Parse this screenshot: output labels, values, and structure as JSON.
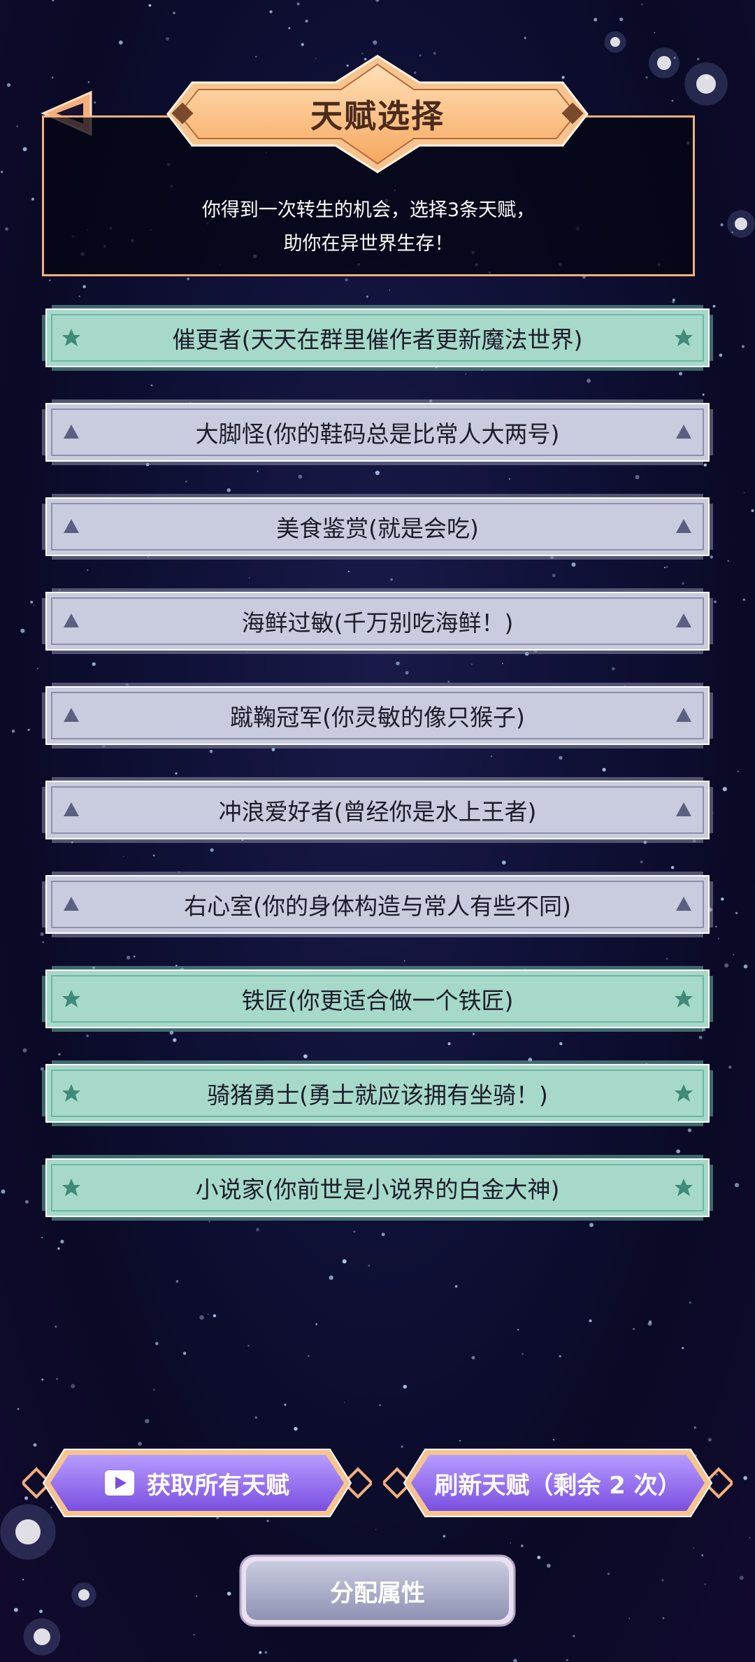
{
  "header": {
    "title": "天赋选择",
    "subtitle_line1": "你得到一次转生的机会，选择3条天赋，",
    "subtitle_line2": "助你在异世界生存！"
  },
  "talents": [
    {
      "label": "催更者(天天在群里催作者更新魔法世界)",
      "rarity": "green"
    },
    {
      "label": "大脚怪(你的鞋码总是比常人大两号)",
      "rarity": "grey"
    },
    {
      "label": "美食鉴赏(就是会吃)",
      "rarity": "grey"
    },
    {
      "label": "海鲜过敏(千万别吃海鲜！)",
      "rarity": "grey"
    },
    {
      "label": "蹴鞠冠军(你灵敏的像只猴子)",
      "rarity": "grey"
    },
    {
      "label": "冲浪爱好者(曾经你是水上王者)",
      "rarity": "grey"
    },
    {
      "label": "右心室(你的身体构造与常人有些不同)",
      "rarity": "grey"
    },
    {
      "label": "铁匠(你更适合做一个铁匠)",
      "rarity": "green"
    },
    {
      "label": "骑猪勇士(勇士就应该拥有坐骑！)",
      "rarity": "green"
    },
    {
      "label": "小说家(你前世是小说界的白金大神)",
      "rarity": "green"
    }
  ],
  "buttons": {
    "get_all": "获取所有天赋",
    "refresh": "刷新天赋（剩余 2 次）",
    "allocate": "分配属性"
  },
  "colors": {
    "green_fill": "#a6d9c9",
    "green_border": "#6fb6a4",
    "grey_fill": "#c9ccde",
    "grey_border": "#8c90aa",
    "gold": "#f3b07a",
    "purple": "#8a5cf0"
  }
}
